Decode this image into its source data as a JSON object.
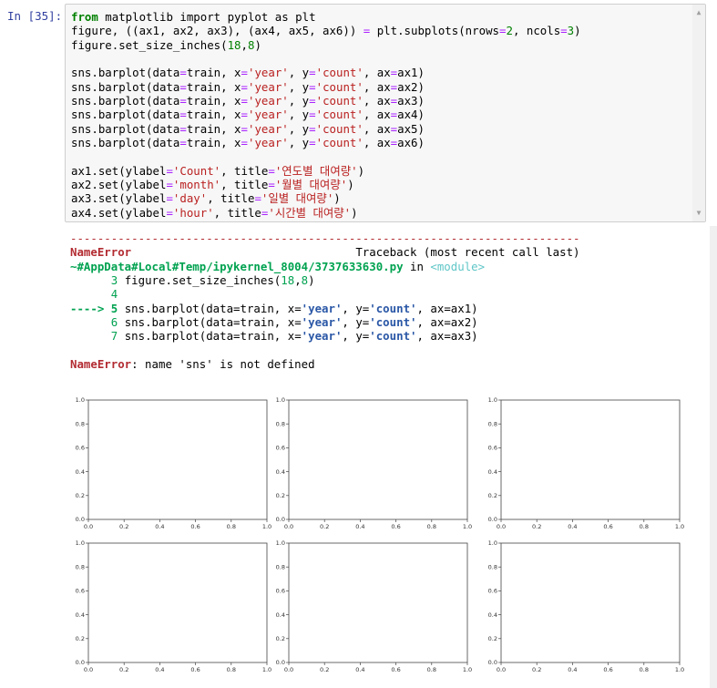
{
  "cell": {
    "prompt": "In [35]:",
    "code_lines": [
      "from matplotlib import pyplot as plt",
      "figure, ((ax1, ax2, ax3), (ax4, ax5, ax6)) = plt.subplots(nrows=2, ncols=3)",
      "figure.set_size_inches(18,8)",
      "",
      "sns.barplot(data=train, x='year', y='count', ax=ax1)",
      "sns.barplot(data=train, x='year', y='count', ax=ax2)",
      "sns.barplot(data=train, x='year', y='count', ax=ax3)",
      "sns.barplot(data=train, x='year', y='count', ax=ax4)",
      "sns.barplot(data=train, x='year', y='count', ax=ax5)",
      "sns.barplot(data=train, x='year', y='count', ax=ax6)",
      "",
      "ax1.set(ylabel='Count', title='연도별 대여량')",
      "ax2.set(ylabel='month', title='월별 대여량')",
      "ax3.set(ylabel='day', title='일별 대여량')",
      "ax4.set(ylabel='hour', title='시간별 대여량')"
    ]
  },
  "output": {
    "separator": "---------------------------------------------------------------------------",
    "error_name": "NameError",
    "traceback_header": "Traceback (most recent call last)",
    "file_path": "~#AppData#Local#Temp/ipykernel_8004/3737633630.py",
    "in_text": "in",
    "module": "<module>",
    "trace_lines": [
      {
        "marker": "      ",
        "num": "3",
        "text": " figure.set_size_inches(18,8)"
      },
      {
        "marker": "      ",
        "num": "4",
        "text": ""
      },
      {
        "marker": "----> ",
        "num": "5",
        "text": " sns.barplot(data=train, x='year', y='count', ax=ax1)"
      },
      {
        "marker": "      ",
        "num": "6",
        "text": " sns.barplot(data=train, x='year', y='count', ax=ax2)"
      },
      {
        "marker": "      ",
        "num": "7",
        "text": " sns.barplot(data=train, x='year', y='count', ax=ax3)"
      }
    ],
    "error_message": ": name 'sns' is not defined"
  },
  "chart_data": [
    {
      "type": "scatter",
      "panel": "ax1",
      "series": [],
      "xlim": [
        0,
        1
      ],
      "ylim": [
        0,
        1
      ],
      "xticks": [
        "0.0",
        "0.2",
        "0.4",
        "0.6",
        "0.8",
        "1.0"
      ],
      "yticks": [
        "0.0",
        "0.2",
        "0.4",
        "0.6",
        "0.8",
        "1.0"
      ]
    },
    {
      "type": "scatter",
      "panel": "ax2",
      "series": [],
      "xlim": [
        0,
        1
      ],
      "ylim": [
        0,
        1
      ],
      "xticks": [
        "0.0",
        "0.2",
        "0.4",
        "0.6",
        "0.8",
        "1.0"
      ],
      "yticks": [
        "0.0",
        "0.2",
        "0.4",
        "0.6",
        "0.8",
        "1.0"
      ]
    },
    {
      "type": "scatter",
      "panel": "ax3",
      "series": [],
      "xlim": [
        0,
        1
      ],
      "ylim": [
        0,
        1
      ],
      "xticks": [
        "0.0",
        "0.2",
        "0.4",
        "0.6",
        "0.8",
        "1.0"
      ],
      "yticks": [
        "0.0",
        "0.2",
        "0.4",
        "0.6",
        "0.8",
        "1.0"
      ]
    },
    {
      "type": "scatter",
      "panel": "ax4",
      "series": [],
      "xlim": [
        0,
        1
      ],
      "ylim": [
        0,
        1
      ],
      "xticks": [
        "0.0",
        "0.2",
        "0.4",
        "0.6",
        "0.8",
        "1.0"
      ],
      "yticks": [
        "0.0",
        "0.2",
        "0.4",
        "0.6",
        "0.8",
        "1.0"
      ]
    },
    {
      "type": "scatter",
      "panel": "ax5",
      "series": [],
      "xlim": [
        0,
        1
      ],
      "ylim": [
        0,
        1
      ],
      "xticks": [
        "0.0",
        "0.2",
        "0.4",
        "0.6",
        "0.8",
        "1.0"
      ],
      "yticks": [
        "0.0",
        "0.2",
        "0.4",
        "0.6",
        "0.8",
        "1.0"
      ]
    },
    {
      "type": "scatter",
      "panel": "ax6",
      "series": [],
      "xlim": [
        0,
        1
      ],
      "ylim": [
        0,
        1
      ],
      "xticks": [
        "0.0",
        "0.2",
        "0.4",
        "0.6",
        "0.8",
        "1.0"
      ],
      "yticks": [
        "0.0",
        "0.2",
        "0.4",
        "0.6",
        "0.8",
        "1.0"
      ]
    }
  ]
}
